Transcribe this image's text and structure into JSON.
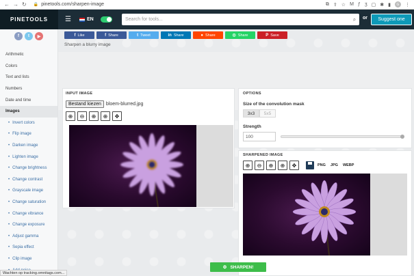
{
  "browser": {
    "url": "pinetools.com/sharpen-image",
    "profile_initial": "G"
  },
  "header": {
    "logo": "PINETOOLS",
    "language": "EN",
    "search_placeholder": "Search for tools...",
    "or_label": "or",
    "suggest_label": "Suggest one"
  },
  "sidebar": {
    "items": [
      {
        "label": "Arithmetic",
        "type": "category"
      },
      {
        "label": "Colors",
        "type": "category"
      },
      {
        "label": "Text and lists",
        "type": "category"
      },
      {
        "label": "Numbers",
        "type": "category"
      },
      {
        "label": "Date and time",
        "type": "category"
      },
      {
        "label": "Images",
        "type": "active"
      },
      {
        "label": "Invert colors",
        "type": "sub"
      },
      {
        "label": "Flip image",
        "type": "sub"
      },
      {
        "label": "Darken image",
        "type": "sub"
      },
      {
        "label": "Lighten image",
        "type": "sub"
      },
      {
        "label": "Change brightness",
        "type": "sub"
      },
      {
        "label": "Change contrast",
        "type": "sub"
      },
      {
        "label": "Grayscale image",
        "type": "sub"
      },
      {
        "label": "Change saturation",
        "type": "sub"
      },
      {
        "label": "Change vibrance",
        "type": "sub"
      },
      {
        "label": "Change exposure",
        "type": "sub"
      },
      {
        "label": "Adjust gamma",
        "type": "sub"
      },
      {
        "label": "Sepia effect",
        "type": "sub"
      },
      {
        "label": "Clip image",
        "type": "sub"
      },
      {
        "label": "Add noise",
        "type": "sub"
      }
    ]
  },
  "share": {
    "like": "Like",
    "share_fb": "Share",
    "tweet": "Tweet",
    "share_li": "Share",
    "share_rd": "Share",
    "share_wa": "Share",
    "save": "Save"
  },
  "page": {
    "subtitle": "Sharpen a blurry image"
  },
  "input_panel": {
    "title": "INPUT IMAGE",
    "file_button": "Bestand kiezen",
    "file_name": "bloem-blurred.jpg"
  },
  "options_panel": {
    "title": "OPTIONS",
    "mask_label": "Size of the convolution mask",
    "mask_options": [
      "3x3",
      "5x5"
    ],
    "strength_label": "Strength",
    "strength_value": "100"
  },
  "sharpened_panel": {
    "title": "SHARPENED IMAGE",
    "formats": [
      "PNG",
      "JPG",
      "WEBP"
    ]
  },
  "action": {
    "sharpen_label": "SHARPEN!"
  },
  "status": {
    "text": "Wachten op tracking.omnitags.com..."
  }
}
